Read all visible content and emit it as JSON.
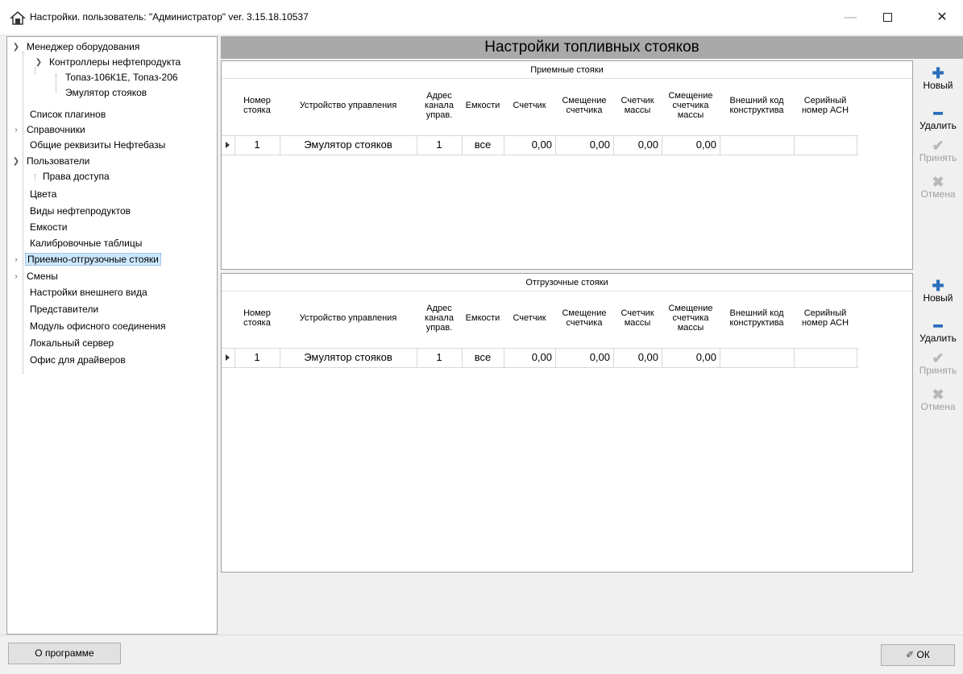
{
  "window": {
    "title": "Настройки. пользователь: \"Администратор\" ver. 3.15.18.10537",
    "min_glyph": "—",
    "close_glyph": "✕"
  },
  "tree": {
    "items": [
      {
        "label": "Менеджер оборудования"
      },
      {
        "label": "Контроллеры нефтепродукта"
      },
      {
        "label": "Топаз-106К1Е, Топаз-206"
      },
      {
        "label": "Эмулятор стояков"
      },
      {
        "label": "Список плагинов"
      },
      {
        "label": "Справочники"
      },
      {
        "label": "Общие реквизиты Нефтебазы"
      },
      {
        "label": "Пользователи"
      },
      {
        "label": "Права доступа"
      },
      {
        "label": "Цвета"
      },
      {
        "label": "Виды нефтепродуктов"
      },
      {
        "label": "Емкости"
      },
      {
        "label": "Калибровочные таблицы"
      },
      {
        "label": "Приемно-отгрузочные стояки"
      },
      {
        "label": "Смены"
      },
      {
        "label": "Настройки внешнего вида"
      },
      {
        "label": "Представители"
      },
      {
        "label": "Модуль офисного соединения"
      },
      {
        "label": "Локальный сервер"
      },
      {
        "label": "Офис для драйверов"
      }
    ]
  },
  "main": {
    "title": "Настройки топливных стояков",
    "columns": [
      "Номер стояка",
      "Устройство управления",
      "Адрес канала управ.",
      "Емкости",
      "Счетчик",
      "Смещение счетчика",
      "Счетчик массы",
      "Смещение счетчика массы",
      "Внешний код конструктива",
      "Серийный номер АСН"
    ],
    "intake": {
      "caption": "Приемные стояки",
      "row": [
        "1",
        "Эмулятор стояков",
        "1",
        "все",
        "0,00",
        "0,00",
        "0,00",
        "0,00",
        "",
        ""
      ]
    },
    "outgoing": {
      "caption": "Отгрузочные стояки",
      "row": [
        "1",
        "Эмулятор стояков",
        "1",
        "все",
        "0,00",
        "0,00",
        "0,00",
        "0,00",
        "",
        ""
      ]
    },
    "side_buttons": {
      "new": "Новый",
      "delete": "Удалить",
      "accept": "Принять",
      "cancel": "Отмена"
    }
  },
  "bottom": {
    "about": "О программе",
    "ok": "ОК"
  }
}
